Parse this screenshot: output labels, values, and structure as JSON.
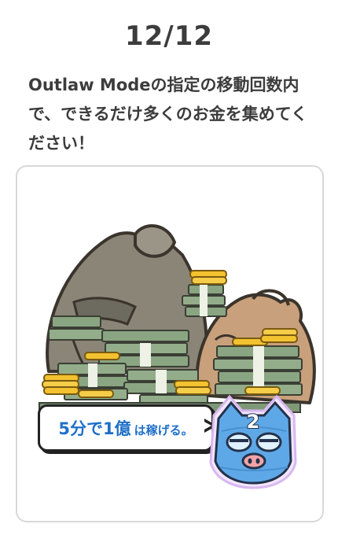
{
  "header": {
    "counter": "12/12",
    "instruction": "Outlaw Modeの指定の移動回数内で、できるだけ多くのお金を集めてください！"
  },
  "card": {
    "bubble_emphasis": "5分で1億",
    "bubble_rest": "は稼げる。",
    "mascot_number": "2"
  },
  "colors": {
    "accent_blue": "#1f6fc8",
    "bill_green": "#8aa582",
    "coin_gold": "#f2c230",
    "sack_gray": "#8a8577",
    "sack_tan": "#c9a07c"
  },
  "icons": {
    "money_bag": "money-bag-icon",
    "mascot": "blue-masked-cat-mascot"
  }
}
